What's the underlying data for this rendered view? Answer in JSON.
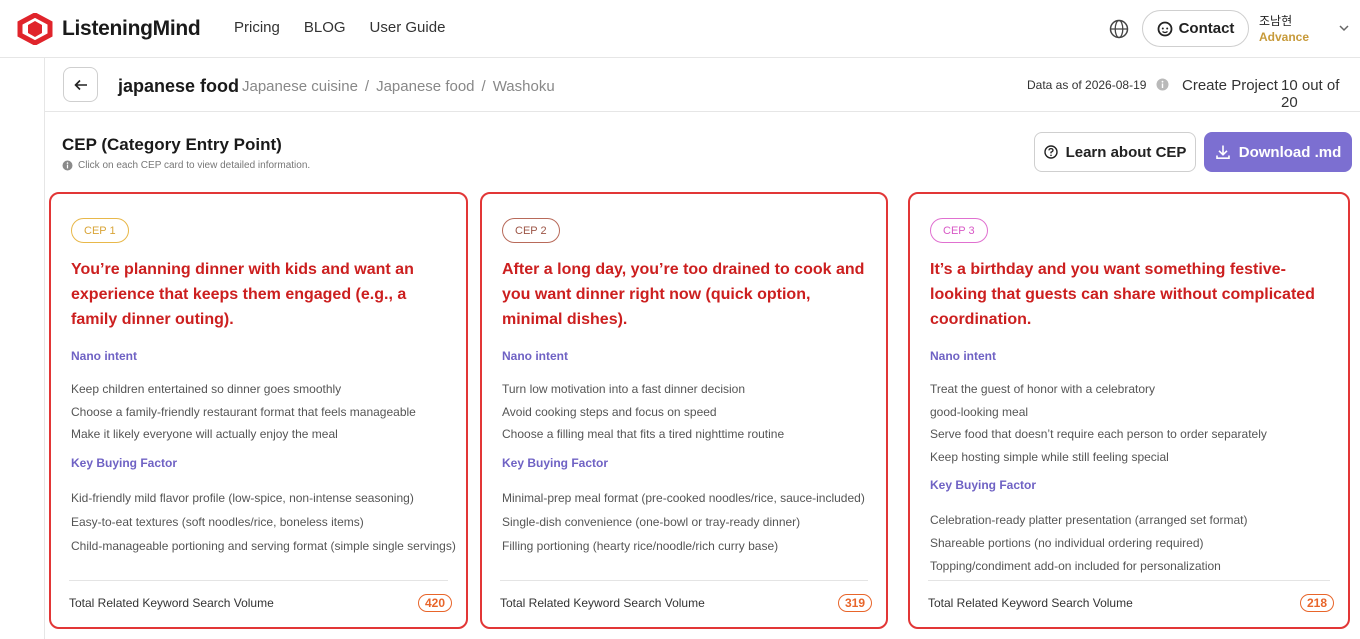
{
  "brand": {
    "name": "ListeningMind"
  },
  "nav": {
    "pricing": "Pricing",
    "blog": "BLOG",
    "guide": "User Guide"
  },
  "contact_label": "Contact",
  "user": {
    "name": "조남현",
    "tier": "Advance"
  },
  "subheader": {
    "keyword": "japanese food",
    "crumbs": [
      "Japanese cuisine",
      "/",
      "Japanese food",
      "/",
      "Washoku"
    ],
    "data_as_of": "Data as of 2026-08-19",
    "create_project": "Create Project",
    "quota": "10 out of 20"
  },
  "section": {
    "title": "CEP (Category Entry Point)",
    "hint": "Click on each CEP card to view detailed information.",
    "learn_label": "Learn about CEP",
    "download_label": "Download .md"
  },
  "cards": [
    {
      "badge": "CEP 1",
      "title": "You’re planning dinner with kids and want an experience that keeps them engaged (e.g., a family dinner outing).",
      "nano_label": "Nano intent",
      "nano": [
        "Keep children entertained so dinner goes smoothly",
        "Choose a family-friendly restaurant format that feels manageable",
        "Make it likely everyone will actually enjoy the meal"
      ],
      "kbf_label": "Key Buying Factor",
      "kbf": [
        "Kid-friendly mild flavor profile (low-spice, non-intense seasoning)",
        "Easy-to-eat textures (soft noodles/rice, boneless items)",
        "Child-manageable portioning and serving format (simple single servings)"
      ],
      "foot": "Total Related Keyword Search Volume",
      "volume": "420"
    },
    {
      "badge": "CEP 2",
      "title": "After a long day, you’re too drained to cook and you want dinner right now (quick option, minimal dishes).",
      "nano_label": "Nano intent",
      "nano": [
        "Turn low motivation into a fast dinner decision",
        "Avoid cooking steps and focus on speed",
        "Choose a filling meal that fits a tired nighttime routine"
      ],
      "kbf_label": "Key Buying Factor",
      "kbf": [
        "Minimal-prep meal format (pre-cooked noodles/rice, sauce-included)",
        "Single-dish convenience (one-bowl or tray-ready dinner)",
        "Filling portioning (hearty rice/noodle/rich curry base)"
      ],
      "foot": "Total Related Keyword Search Volume",
      "volume": "319"
    },
    {
      "badge": "CEP 3",
      "title": "It’s a birthday and you want something festive-looking that guests can share without complicated coordination.",
      "nano_label": "Nano intent",
      "nano": [
        "Treat the guest of honor with a celebratory",
        "good-looking meal",
        "Serve food that doesn’t require each person to order separately",
        "Keep hosting simple while still feeling special"
      ],
      "kbf_label": "Key Buying Factor",
      "kbf": [
        "Celebration-ready platter presentation (arranged set format)",
        "Shareable portions (no individual ordering required)",
        "Topping/condiment add-on included for personalization"
      ],
      "foot": "Total Related Keyword Search Volume",
      "volume": "218"
    }
  ],
  "colors": {
    "accent": "#7c6fd1",
    "card_border": "#e23636",
    "title_red": "#cc1f1f",
    "volume_orange": "#e8652a",
    "badge1": "#e8b84a",
    "badge2": "#b86a5a",
    "badge3": "#e070d0"
  }
}
